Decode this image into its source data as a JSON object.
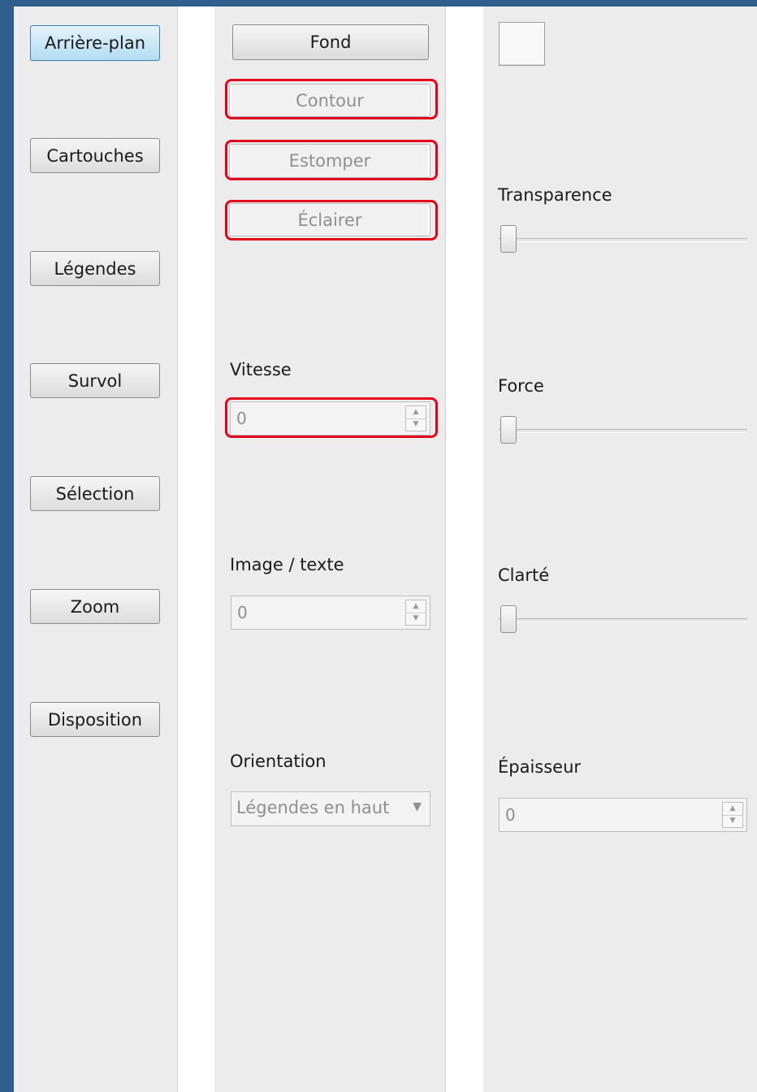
{
  "nav": {
    "buttons": [
      {
        "label": "Arrière-plan",
        "active": true
      },
      {
        "label": "Cartouches"
      },
      {
        "label": "Légendes"
      },
      {
        "label": "Survol"
      },
      {
        "label": "Sélection"
      },
      {
        "label": "Zoom"
      },
      {
        "label": "Disposition"
      }
    ]
  },
  "middle": {
    "fond_label": "Fond",
    "contour_label": "Contour",
    "estomper_label": "Estomper",
    "eclairer_label": "Éclairer",
    "vitesse": {
      "label": "Vitesse",
      "value": "0"
    },
    "image_texte": {
      "label": "Image / texte",
      "value": "0"
    },
    "orientation": {
      "label": "Orientation",
      "selected": "Légendes en haut"
    }
  },
  "right": {
    "transparence": {
      "label": "Transparence",
      "value": 0
    },
    "force": {
      "label": "Force",
      "value": 0
    },
    "clarte": {
      "label": "Clarté",
      "value": 0
    },
    "epaisseur": {
      "label": "Épaisseur",
      "value": "0"
    }
  },
  "colors": {
    "background": "#2f5f8d",
    "highlight": "#e3001b",
    "active_button": "#b4dcf3"
  }
}
